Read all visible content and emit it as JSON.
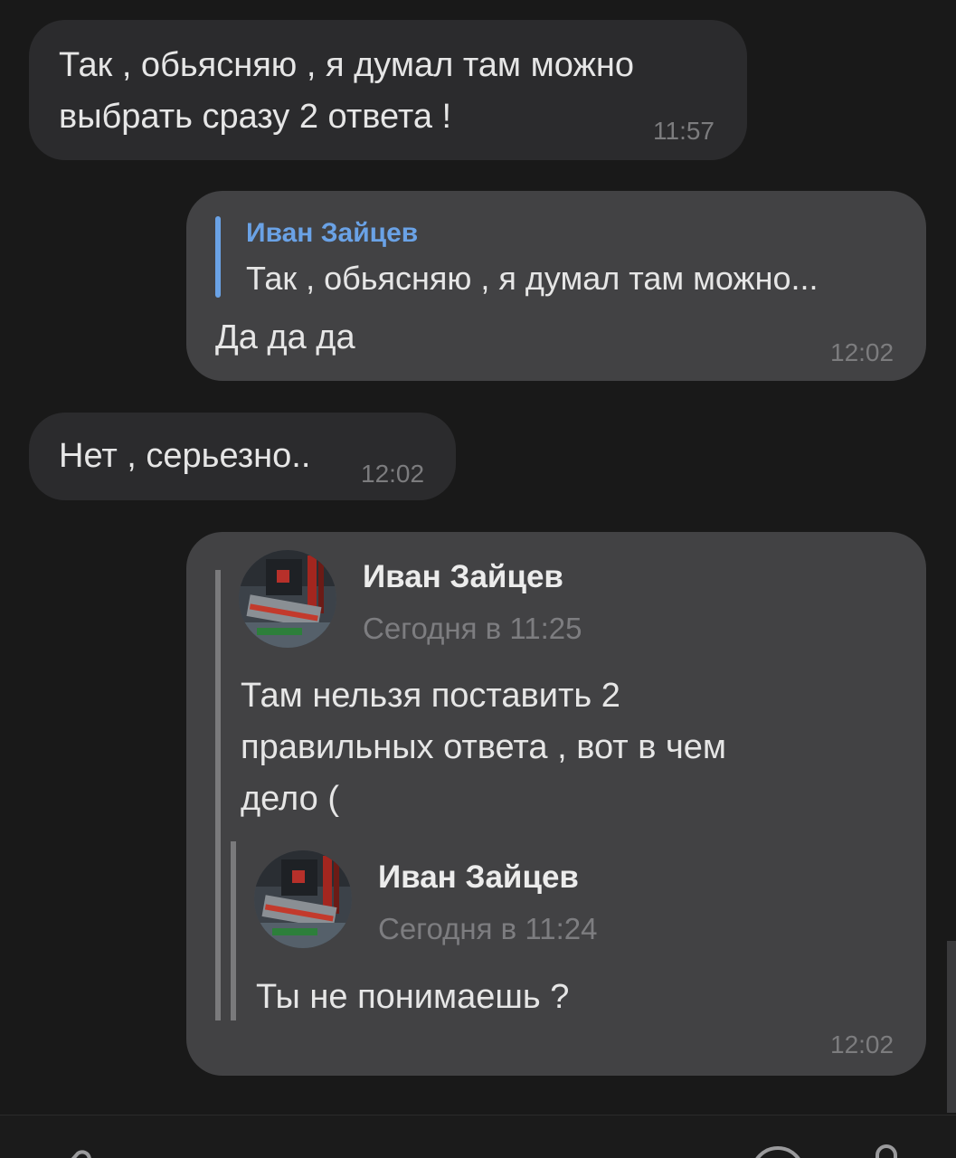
{
  "messages": [
    {
      "type": "incoming",
      "text": "Так , обьясняю , я думал там можно\nвыбрать сразу 2 ответа !",
      "time": "11:57"
    },
    {
      "type": "outgoing-reply",
      "reply_to": {
        "author": "Иван Зайцев",
        "snippet": "Так , обьясняю , я думал там можно..."
      },
      "text": "Да да да",
      "time": "12:02"
    },
    {
      "type": "incoming",
      "text": "Нет , серьезно..",
      "time": "12:02"
    },
    {
      "type": "outgoing-forward",
      "forward": {
        "author": "Иван Зайцев",
        "date": "Сегодня в 11:25",
        "text": "Там нельзя поставить 2\nправильных ответа , вот в чем\nдело (",
        "nested": {
          "author": "Иван Зайцев",
          "date": "Сегодня в 11:24",
          "text": "Ты не понимаешь ?"
        }
      },
      "time": "12:02"
    }
  ],
  "composer": {
    "left_icon": "attach-icon",
    "right_icons": [
      "emoji-icon",
      "microphone-icon"
    ]
  },
  "colors": {
    "background": "#191919",
    "incoming_bubble": "#2b2b2d",
    "outgoing_bubble": "#424244",
    "reply_accent": "#6aa2e6"
  }
}
